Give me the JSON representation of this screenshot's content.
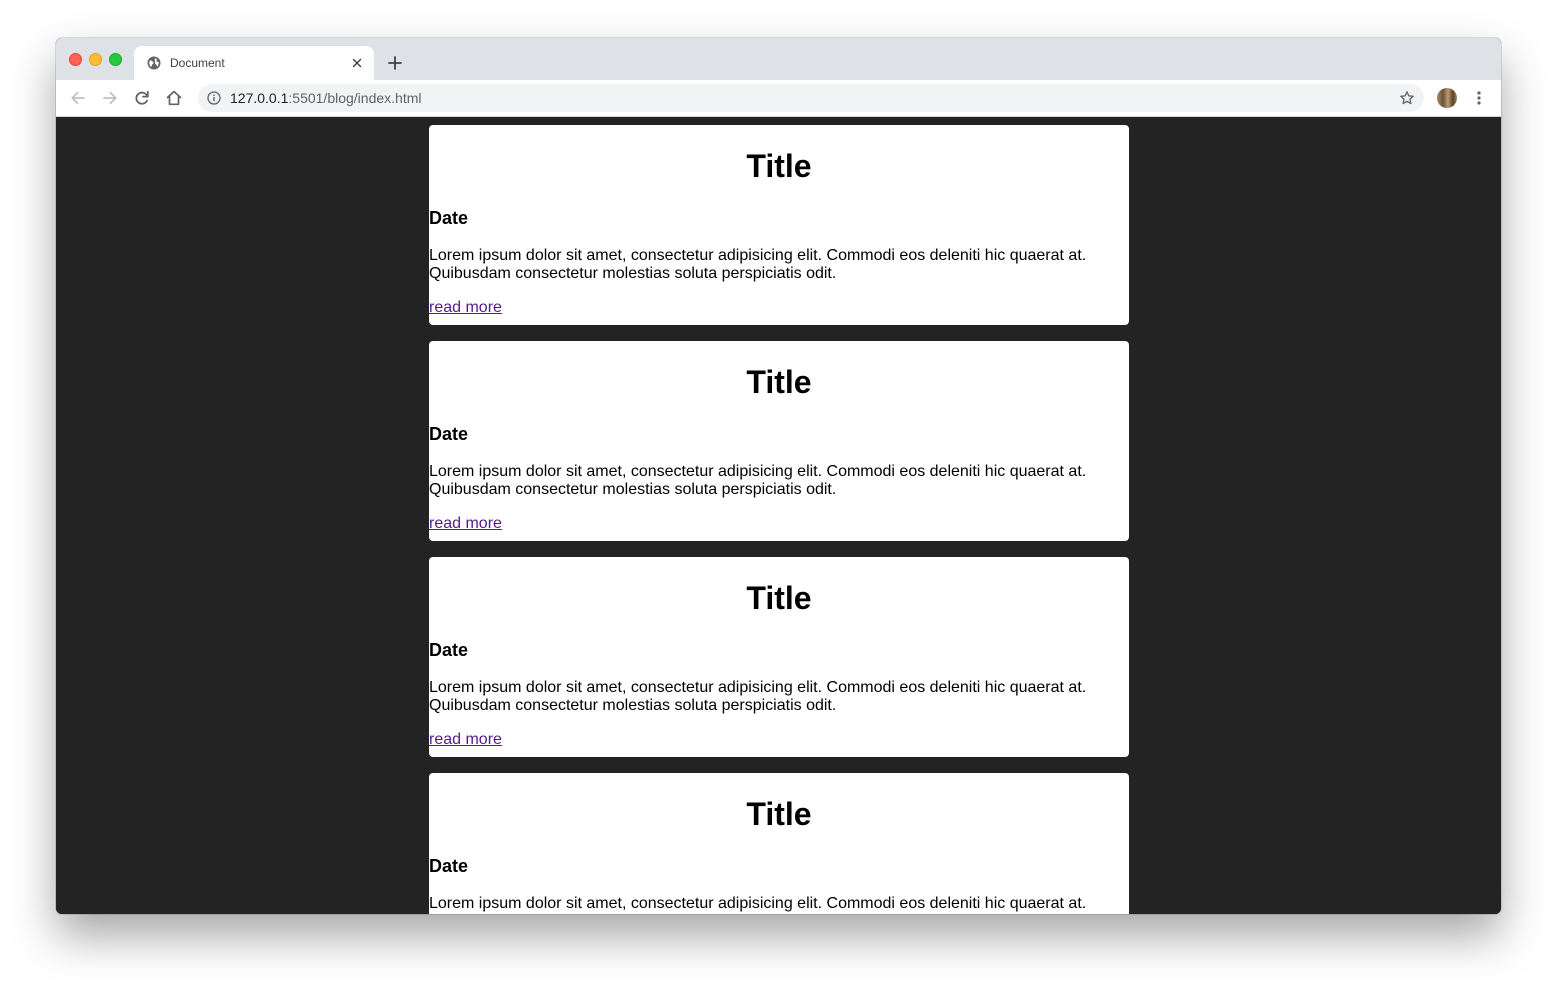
{
  "browser": {
    "tab_title": "Document",
    "url_host": "127.0.0.1",
    "url_rest": ":5501/blog/index.html"
  },
  "posts": [
    {
      "title": "Title",
      "date": "Date",
      "body": "Lorem ipsum dolor sit amet, consectetur adipisicing elit. Commodi eos deleniti hic quaerat at. Quibusdam consectetur molestias soluta perspiciatis odit.",
      "link": "read more"
    },
    {
      "title": "Title",
      "date": "Date",
      "body": "Lorem ipsum dolor sit amet, consectetur adipisicing elit. Commodi eos deleniti hic quaerat at. Quibusdam consectetur molestias soluta perspiciatis odit.",
      "link": "read more"
    },
    {
      "title": "Title",
      "date": "Date",
      "body": "Lorem ipsum dolor sit amet, consectetur adipisicing elit. Commodi eos deleniti hic quaerat at. Quibusdam consectetur molestias soluta perspiciatis odit.",
      "link": "read more"
    },
    {
      "title": "Title",
      "date": "Date",
      "body": "Lorem ipsum dolor sit amet, consectetur adipisicing elit. Commodi eos deleniti hic quaerat at.",
      "link": ""
    }
  ],
  "colors": {
    "page_background": "#232323",
    "card_background": "#ffffff",
    "visited_link": "#551a8b"
  }
}
